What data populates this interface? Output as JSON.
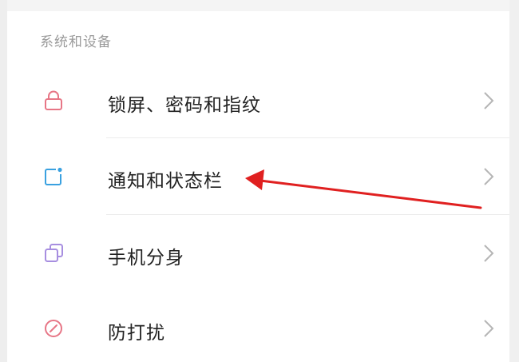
{
  "section": {
    "header": "系统和设备"
  },
  "items": [
    {
      "label": "锁屏、密码和指纹",
      "icon": "lock-icon",
      "color": "#e77686"
    },
    {
      "label": "通知和状态栏",
      "icon": "notification-icon",
      "color": "#3aa1e0"
    },
    {
      "label": "手机分身",
      "icon": "dual-app-icon",
      "color": "#a78ee0"
    },
    {
      "label": "防打扰",
      "icon": "do-not-disturb-icon",
      "color": "#e77686"
    }
  ],
  "chevron_icon": "chevron-right-icon",
  "annotation": {
    "icon": "red-arrow-icon",
    "color": "#e02020"
  }
}
